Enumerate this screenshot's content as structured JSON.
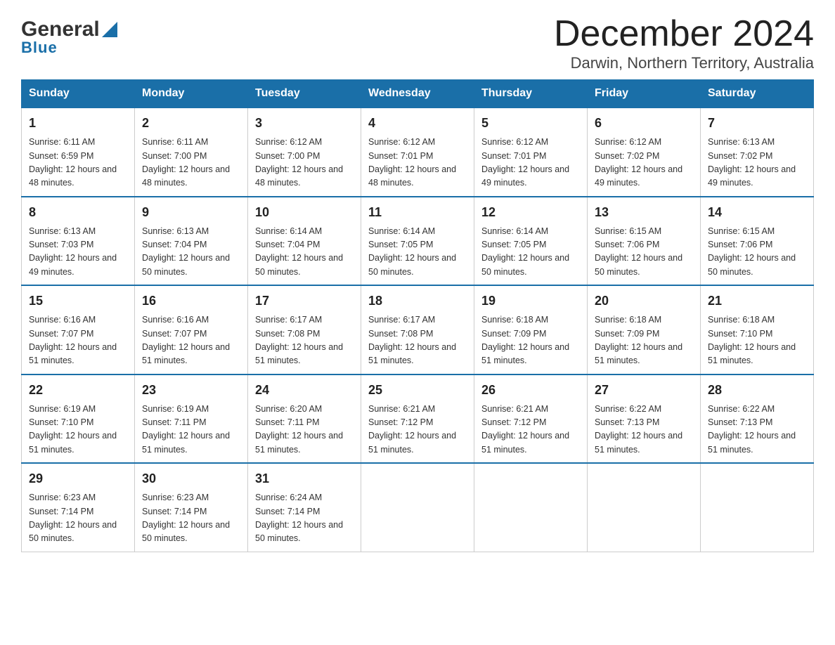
{
  "logo": {
    "general": "General",
    "blue": "Blue"
  },
  "title": "December 2024",
  "subtitle": "Darwin, Northern Territory, Australia",
  "days_header": [
    "Sunday",
    "Monday",
    "Tuesday",
    "Wednesday",
    "Thursday",
    "Friday",
    "Saturday"
  ],
  "weeks": [
    [
      {
        "day": "1",
        "sunrise": "6:11 AM",
        "sunset": "6:59 PM",
        "daylight": "12 hours and 48 minutes."
      },
      {
        "day": "2",
        "sunrise": "6:11 AM",
        "sunset": "7:00 PM",
        "daylight": "12 hours and 48 minutes."
      },
      {
        "day": "3",
        "sunrise": "6:12 AM",
        "sunset": "7:00 PM",
        "daylight": "12 hours and 48 minutes."
      },
      {
        "day": "4",
        "sunrise": "6:12 AM",
        "sunset": "7:01 PM",
        "daylight": "12 hours and 48 minutes."
      },
      {
        "day": "5",
        "sunrise": "6:12 AM",
        "sunset": "7:01 PM",
        "daylight": "12 hours and 49 minutes."
      },
      {
        "day": "6",
        "sunrise": "6:12 AM",
        "sunset": "7:02 PM",
        "daylight": "12 hours and 49 minutes."
      },
      {
        "day": "7",
        "sunrise": "6:13 AM",
        "sunset": "7:02 PM",
        "daylight": "12 hours and 49 minutes."
      }
    ],
    [
      {
        "day": "8",
        "sunrise": "6:13 AM",
        "sunset": "7:03 PM",
        "daylight": "12 hours and 49 minutes."
      },
      {
        "day": "9",
        "sunrise": "6:13 AM",
        "sunset": "7:04 PM",
        "daylight": "12 hours and 50 minutes."
      },
      {
        "day": "10",
        "sunrise": "6:14 AM",
        "sunset": "7:04 PM",
        "daylight": "12 hours and 50 minutes."
      },
      {
        "day": "11",
        "sunrise": "6:14 AM",
        "sunset": "7:05 PM",
        "daylight": "12 hours and 50 minutes."
      },
      {
        "day": "12",
        "sunrise": "6:14 AM",
        "sunset": "7:05 PM",
        "daylight": "12 hours and 50 minutes."
      },
      {
        "day": "13",
        "sunrise": "6:15 AM",
        "sunset": "7:06 PM",
        "daylight": "12 hours and 50 minutes."
      },
      {
        "day": "14",
        "sunrise": "6:15 AM",
        "sunset": "7:06 PM",
        "daylight": "12 hours and 50 minutes."
      }
    ],
    [
      {
        "day": "15",
        "sunrise": "6:16 AM",
        "sunset": "7:07 PM",
        "daylight": "12 hours and 51 minutes."
      },
      {
        "day": "16",
        "sunrise": "6:16 AM",
        "sunset": "7:07 PM",
        "daylight": "12 hours and 51 minutes."
      },
      {
        "day": "17",
        "sunrise": "6:17 AM",
        "sunset": "7:08 PM",
        "daylight": "12 hours and 51 minutes."
      },
      {
        "day": "18",
        "sunrise": "6:17 AM",
        "sunset": "7:08 PM",
        "daylight": "12 hours and 51 minutes."
      },
      {
        "day": "19",
        "sunrise": "6:18 AM",
        "sunset": "7:09 PM",
        "daylight": "12 hours and 51 minutes."
      },
      {
        "day": "20",
        "sunrise": "6:18 AM",
        "sunset": "7:09 PM",
        "daylight": "12 hours and 51 minutes."
      },
      {
        "day": "21",
        "sunrise": "6:18 AM",
        "sunset": "7:10 PM",
        "daylight": "12 hours and 51 minutes."
      }
    ],
    [
      {
        "day": "22",
        "sunrise": "6:19 AM",
        "sunset": "7:10 PM",
        "daylight": "12 hours and 51 minutes."
      },
      {
        "day": "23",
        "sunrise": "6:19 AM",
        "sunset": "7:11 PM",
        "daylight": "12 hours and 51 minutes."
      },
      {
        "day": "24",
        "sunrise": "6:20 AM",
        "sunset": "7:11 PM",
        "daylight": "12 hours and 51 minutes."
      },
      {
        "day": "25",
        "sunrise": "6:21 AM",
        "sunset": "7:12 PM",
        "daylight": "12 hours and 51 minutes."
      },
      {
        "day": "26",
        "sunrise": "6:21 AM",
        "sunset": "7:12 PM",
        "daylight": "12 hours and 51 minutes."
      },
      {
        "day": "27",
        "sunrise": "6:22 AM",
        "sunset": "7:13 PM",
        "daylight": "12 hours and 51 minutes."
      },
      {
        "day": "28",
        "sunrise": "6:22 AM",
        "sunset": "7:13 PM",
        "daylight": "12 hours and 51 minutes."
      }
    ],
    [
      {
        "day": "29",
        "sunrise": "6:23 AM",
        "sunset": "7:14 PM",
        "daylight": "12 hours and 50 minutes."
      },
      {
        "day": "30",
        "sunrise": "6:23 AM",
        "sunset": "7:14 PM",
        "daylight": "12 hours and 50 minutes."
      },
      {
        "day": "31",
        "sunrise": "6:24 AM",
        "sunset": "7:14 PM",
        "daylight": "12 hours and 50 minutes."
      },
      null,
      null,
      null,
      null
    ]
  ],
  "labels": {
    "sunrise": "Sunrise:",
    "sunset": "Sunset:",
    "daylight": "Daylight:"
  }
}
